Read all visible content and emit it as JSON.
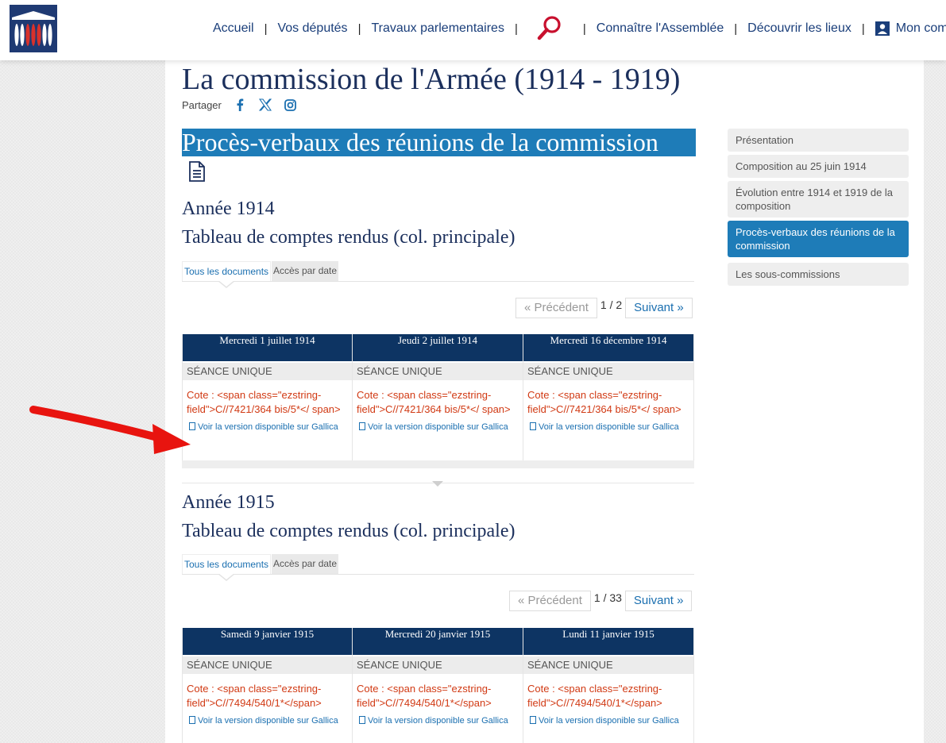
{
  "header": {
    "nav": [
      {
        "label": "Accueil"
      },
      {
        "label": "Vos députés"
      },
      {
        "label": "Travaux parlementaires"
      },
      {
        "label": "Connaître l'Assemblée"
      },
      {
        "label": "Découvrir les lieux"
      },
      {
        "label": "Mon comp"
      }
    ],
    "separator": "|"
  },
  "page": {
    "title": "La commission de l'Armée (1914 - 1919)",
    "share_label": "Partager",
    "share_icons": [
      "facebook-icon",
      "x-icon",
      "instagram-icon"
    ],
    "section_title": "Procès-verbaux des réunions de la commission"
  },
  "years": [
    {
      "year_label": "Année 1914",
      "table_title": "Tableau de comptes rendus (col. principale)",
      "tabs": [
        "Tous les documents",
        "Accès par date"
      ],
      "pager": {
        "prev": "« Précédent",
        "count": "1 / 2",
        "next": "Suivant »"
      },
      "entries": [
        {
          "date": "Mercredi 1 juillet 1914",
          "seance": "SÉANCE UNIQUE",
          "cote": "Cote : <span class=\"ezstring-field\">C//7421/364 bis/5*</ span>",
          "gallica": "Voir la version disponible sur Gallica"
        },
        {
          "date": "Jeudi 2 juillet 1914",
          "seance": "SÉANCE UNIQUE",
          "cote": "Cote : <span class=\"ezstring-field\">C//7421/364 bis/5*</ span>",
          "gallica": "Voir la version disponible sur Gallica"
        },
        {
          "date": "Mercredi 16 décembre 1914",
          "seance": "SÉANCE UNIQUE",
          "cote": "Cote : <span class=\"ezstring-field\">C//7421/364 bis/5*</ span>",
          "gallica": "Voir la version disponible sur Gallica"
        }
      ]
    },
    {
      "year_label": "Année 1915",
      "table_title": "Tableau de comptes rendus (col. principale)",
      "tabs": [
        "Tous les documents",
        "Accès par date"
      ],
      "pager": {
        "prev": "« Précédent",
        "count": "1 / 33",
        "next": "Suivant »"
      },
      "entries": [
        {
          "date": "Samedi 9 janvier 1915",
          "seance": "SÉANCE UNIQUE",
          "cote": "Cote : <span class=\"ezstring-field\">C//7494/540/1*</span>",
          "gallica": "Voir la version disponible sur Gallica"
        },
        {
          "date": "Mercredi 20 janvier 1915",
          "seance": "SÉANCE UNIQUE",
          "cote": "Cote : <span class=\"ezstring-field\">C//7494/540/1*</span>",
          "gallica": "Voir la version disponible sur Gallica"
        },
        {
          "date": "Lundi 11 janvier 1915",
          "seance": "SÉANCE UNIQUE",
          "cote": "Cote : <span class=\"ezstring-field\">C//7494/540/1*</span>",
          "gallica": "Voir la version disponible sur Gallica"
        }
      ]
    }
  ],
  "sidebar": {
    "items": [
      {
        "label": "Présentation",
        "active": false
      },
      {
        "label": "Composition au 25 juin 1914",
        "active": false
      },
      {
        "label": "Évolution entre 1914 et 1919 de la composition",
        "active": false
      },
      {
        "label": "Procès-verbaux des réunions de la commission",
        "active": true
      },
      {
        "label": "Les sous-commissions",
        "active": false
      }
    ]
  },
  "colors": {
    "navy": "#0d3463",
    "accent_blue": "#1e7cb8",
    "link_blue": "#1a6fb0",
    "cote_red": "#d13a14",
    "arrow_red": "#e8140f"
  }
}
